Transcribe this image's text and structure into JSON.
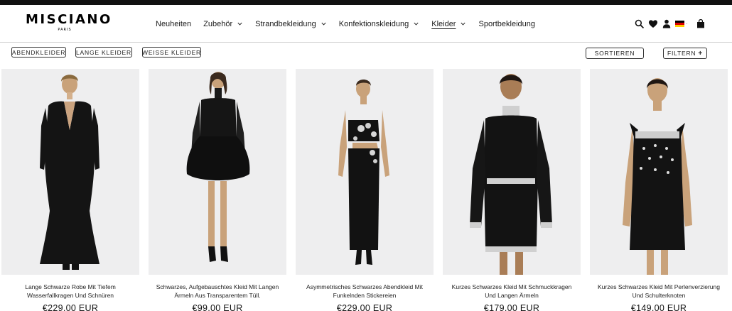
{
  "brand": {
    "name": "MISCIANO",
    "sub": "PARIS"
  },
  "nav": {
    "items": [
      {
        "label": "Neuheiten",
        "dropdown": false,
        "active": false
      },
      {
        "label": "Zubehör",
        "dropdown": true,
        "active": false
      },
      {
        "label": "Strandbekleidung",
        "dropdown": true,
        "active": false
      },
      {
        "label": "Konfektionskleidung",
        "dropdown": true,
        "active": false
      },
      {
        "label": "Kleider",
        "dropdown": true,
        "active": true
      },
      {
        "label": "Sportbekleidung",
        "dropdown": false,
        "active": false
      }
    ]
  },
  "header_icons": [
    "search-icon",
    "heart-icon",
    "account-icon",
    "german-flag-icon",
    "bag-icon"
  ],
  "filter_chips": [
    "ABENDKLEIDER",
    "LANGE KLEIDER",
    "WEISSE KLEIDER"
  ],
  "sort_label": "SORTIEREN",
  "filter_label": "FILTERN",
  "filter_icon_glyph": "+",
  "colors": {
    "accent": "#111111",
    "image_bg": "#eeeeef",
    "divider": "#cfcfcf"
  },
  "products": [
    {
      "name": "Lange Schwarze Robe Mit Tiefem Wasserfallkragen Und Schnüren",
      "price": "€229,00 EUR"
    },
    {
      "name": "Schwarzes, Aufgebauschtes Kleid Mit Langen Ärmeln Aus Transparentem Tüll.",
      "price": "€99,00 EUR"
    },
    {
      "name": "Asymmetrisches Schwarzes Abendkleid Mit Funkelnden Stickereien",
      "price": "€229,00 EUR"
    },
    {
      "name": "Kurzes Schwarzes Kleid Mit Schmuckkragen Und Langen Ärmeln",
      "price": "€179,00 EUR"
    },
    {
      "name": "Kurzes Schwarzes Kleid Mit Perlenverzierung Und Schulterknoten",
      "price": "€149,00 EUR"
    }
  ]
}
